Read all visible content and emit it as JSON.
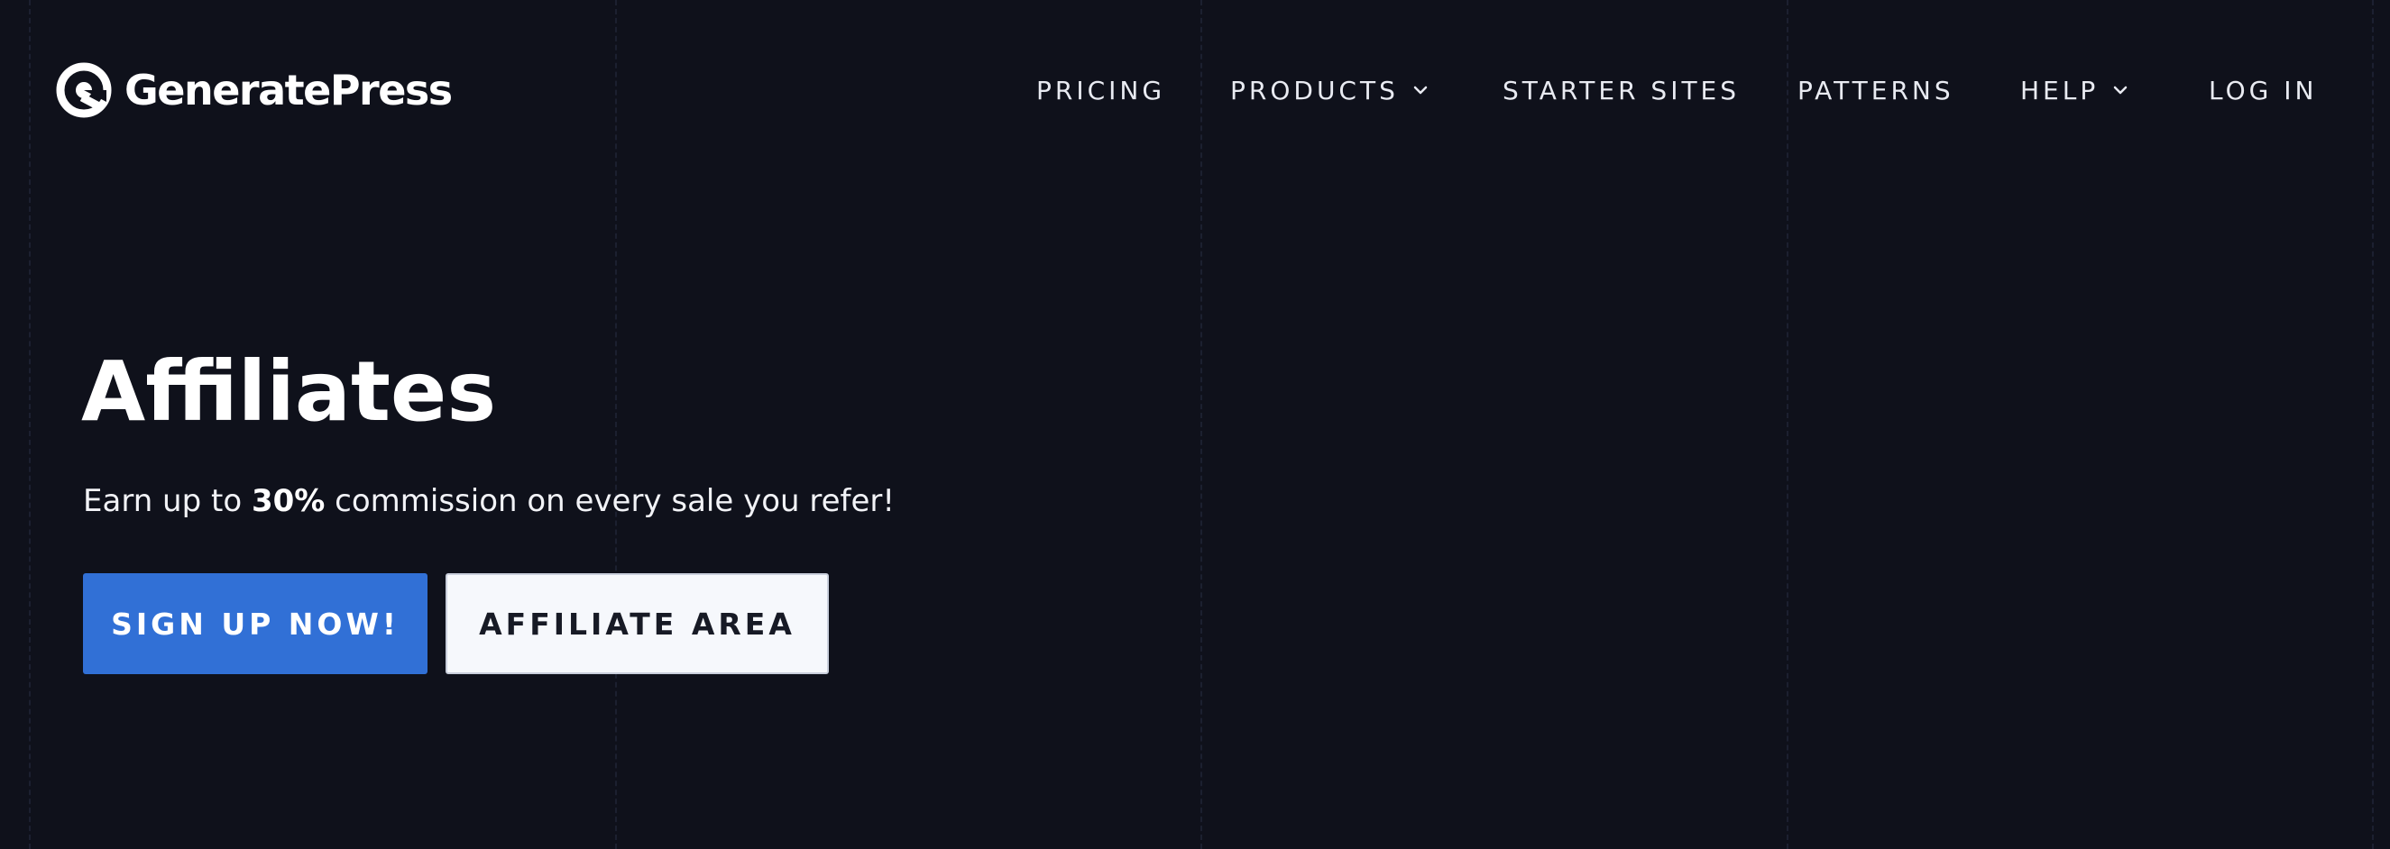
{
  "colors": {
    "background": "#0f111b",
    "primary_button": "#3170d6",
    "secondary_button": "#f6f8fc",
    "text": "#ffffff"
  },
  "brand": {
    "name": "GeneratePress",
    "icon": "generatepress-logo-icon"
  },
  "nav": {
    "pricing": "PRICING",
    "products": "PRODUCTS",
    "starter_sites": "STARTER SITES",
    "patterns": "PATTERNS",
    "help": "HELP",
    "log_in": "LOG IN"
  },
  "hero": {
    "title": "Affiliates",
    "subtitle_before": "Earn up to ",
    "subtitle_highlight": "30%",
    "subtitle_after": " commission on every sale you refer!"
  },
  "buttons": {
    "sign_up": "SIGN UP NOW!",
    "affiliate_area": "AFFILIATE AREA"
  }
}
